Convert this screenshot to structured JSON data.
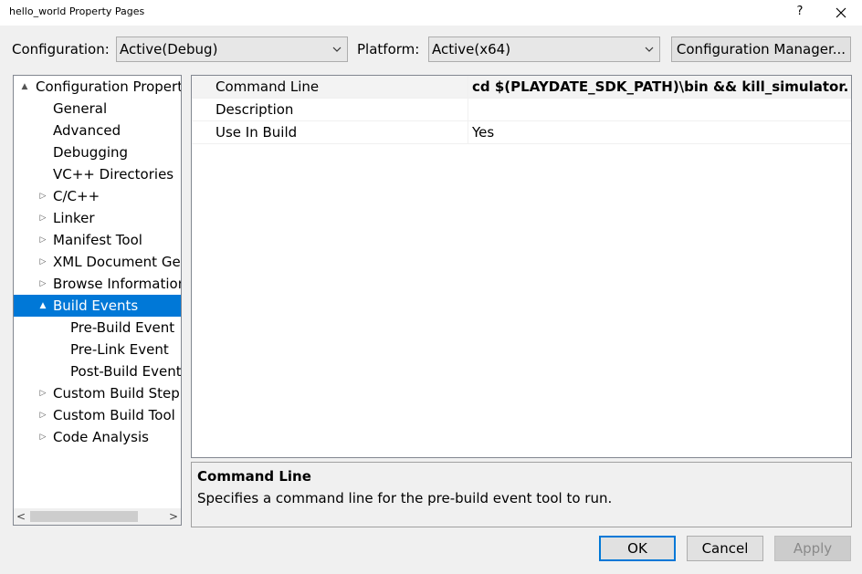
{
  "window": {
    "title": "hello_world Property Pages",
    "help_label": "?"
  },
  "toolbar": {
    "configuration_label": "Configuration:",
    "configuration_value": "Active(Debug)",
    "platform_label": "Platform:",
    "platform_value": "Active(x64)",
    "config_manager_label": "Configuration Manager..."
  },
  "tree": {
    "items": [
      {
        "label": "Configuration Properties",
        "expander": "▲"
      },
      {
        "label": "General"
      },
      {
        "label": "Advanced"
      },
      {
        "label": "Debugging"
      },
      {
        "label": "VC++ Directories"
      },
      {
        "label": "C/C++",
        "expander": "▷"
      },
      {
        "label": "Linker",
        "expander": "▷"
      },
      {
        "label": "Manifest Tool",
        "expander": "▷"
      },
      {
        "label": "XML Document Generator",
        "expander": "▷"
      },
      {
        "label": "Browse Information",
        "expander": "▷"
      },
      {
        "label": "Build Events",
        "expander": "▲"
      },
      {
        "label": "Pre-Build Event"
      },
      {
        "label": "Pre-Link Event"
      },
      {
        "label": "Post-Build Event"
      },
      {
        "label": "Custom Build Step",
        "expander": "▷"
      },
      {
        "label": "Custom Build Tool",
        "expander": "▷"
      },
      {
        "label": "Code Analysis",
        "expander": "▷"
      }
    ],
    "scroll_left": "<",
    "scroll_right": ">"
  },
  "grid": {
    "rows": [
      {
        "name": "Command Line",
        "value": "cd $(PLAYDATE_SDK_PATH)\\bin && kill_simulator.bat"
      },
      {
        "name": "Description",
        "value": ""
      },
      {
        "name": "Use In Build",
        "value": "Yes"
      }
    ]
  },
  "description": {
    "title": "Command Line",
    "text": "Specifies a command line for the pre-build event tool to run."
  },
  "buttons": {
    "ok": "OK",
    "cancel": "Cancel",
    "apply": "Apply"
  },
  "colors": {
    "accent": "#0078d7",
    "selected_text": "#ffffff"
  }
}
